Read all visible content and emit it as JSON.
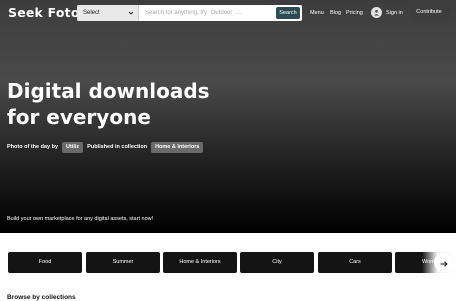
{
  "header": {
    "logo": "Seek Foto",
    "search": {
      "select_value": "Select",
      "placeholder": "Search for anything, try `Outdoor` ...",
      "button_label": "Search"
    },
    "nav": {
      "menu": "Menu",
      "blog": "Blog",
      "pricing": "Pricing"
    },
    "signin_label": "Sign in",
    "contribute_label": "Contribute"
  },
  "hero": {
    "title_line1": "Digital downloads",
    "title_line2": "for everyone",
    "photo_of_day_label": "Photo of the day by",
    "photographer": "Utiliz",
    "published_label": "Published in collection",
    "collection": "Home & Interiors",
    "subtitle": "Build your own marketplace for any digital assets, start now!"
  },
  "categories": [
    "Food",
    "Summer",
    "Home & Interiors",
    "City",
    "Cars",
    "Women"
  ],
  "browse_heading": "Browse by collections",
  "icons": {
    "select": "chevron-down-icon",
    "user": "user-icon",
    "scroll": "arrow-right-icon"
  },
  "colors": {
    "search_button": "#2c4c54",
    "category_tile": "#141414",
    "chip": "#6a6a6a",
    "contribute": "#3d3d3d"
  }
}
